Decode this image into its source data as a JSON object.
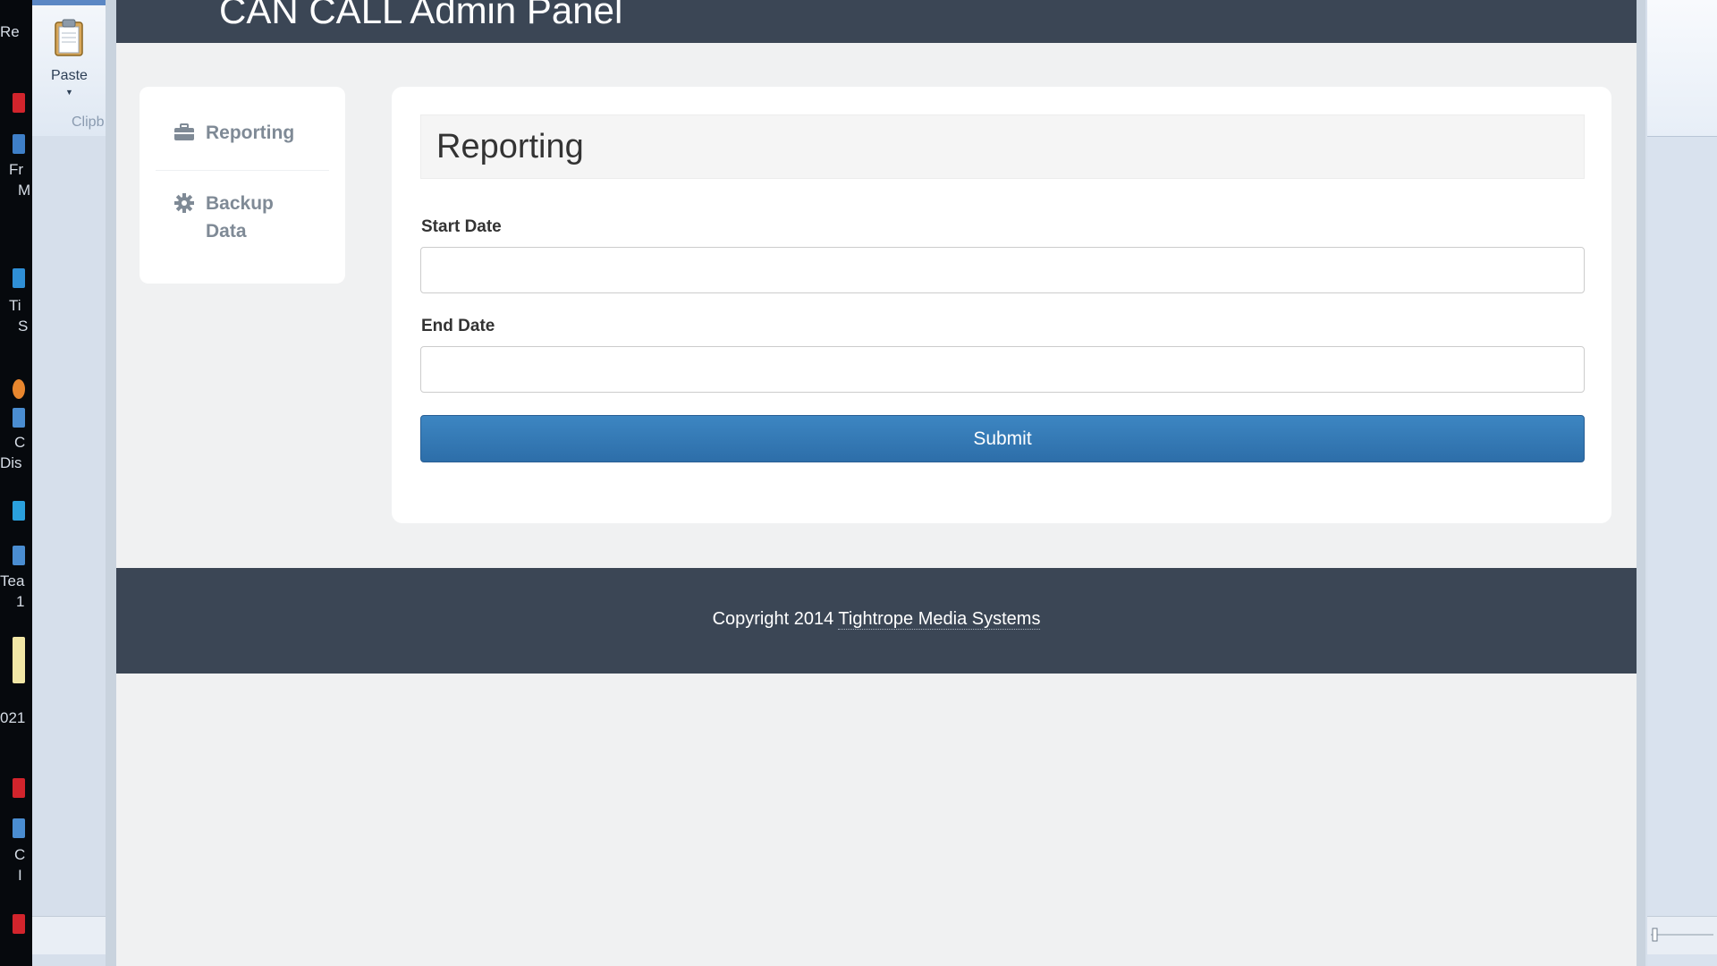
{
  "desktop": {
    "fragments": [
      "Re",
      "Fr",
      "M",
      "Ti",
      "S",
      "C",
      "Dis",
      "Tea",
      "1",
      "021",
      "C",
      "I"
    ]
  },
  "background_app": {
    "paste_label": "Paste",
    "clipboard_label": "Clipb"
  },
  "app": {
    "brand": "CAN CALL Admin Panel",
    "sidebar": {
      "items": [
        {
          "label": "Reporting",
          "icon": "briefcase-icon"
        },
        {
          "label": "Backup Data",
          "icon": "gear-icon"
        }
      ]
    },
    "panel": {
      "title": "Reporting",
      "start_date_label": "Start Date",
      "start_date_value": "",
      "end_date_label": "End Date",
      "end_date_value": "",
      "submit_label": "Submit"
    },
    "footer": {
      "text": "Copyright 2014",
      "link_text": "Tightrope Media Systems"
    },
    "colors": {
      "navbar": "#3b4655",
      "primary_button": "#337ab7",
      "page_background": "#f0f1f2"
    }
  }
}
